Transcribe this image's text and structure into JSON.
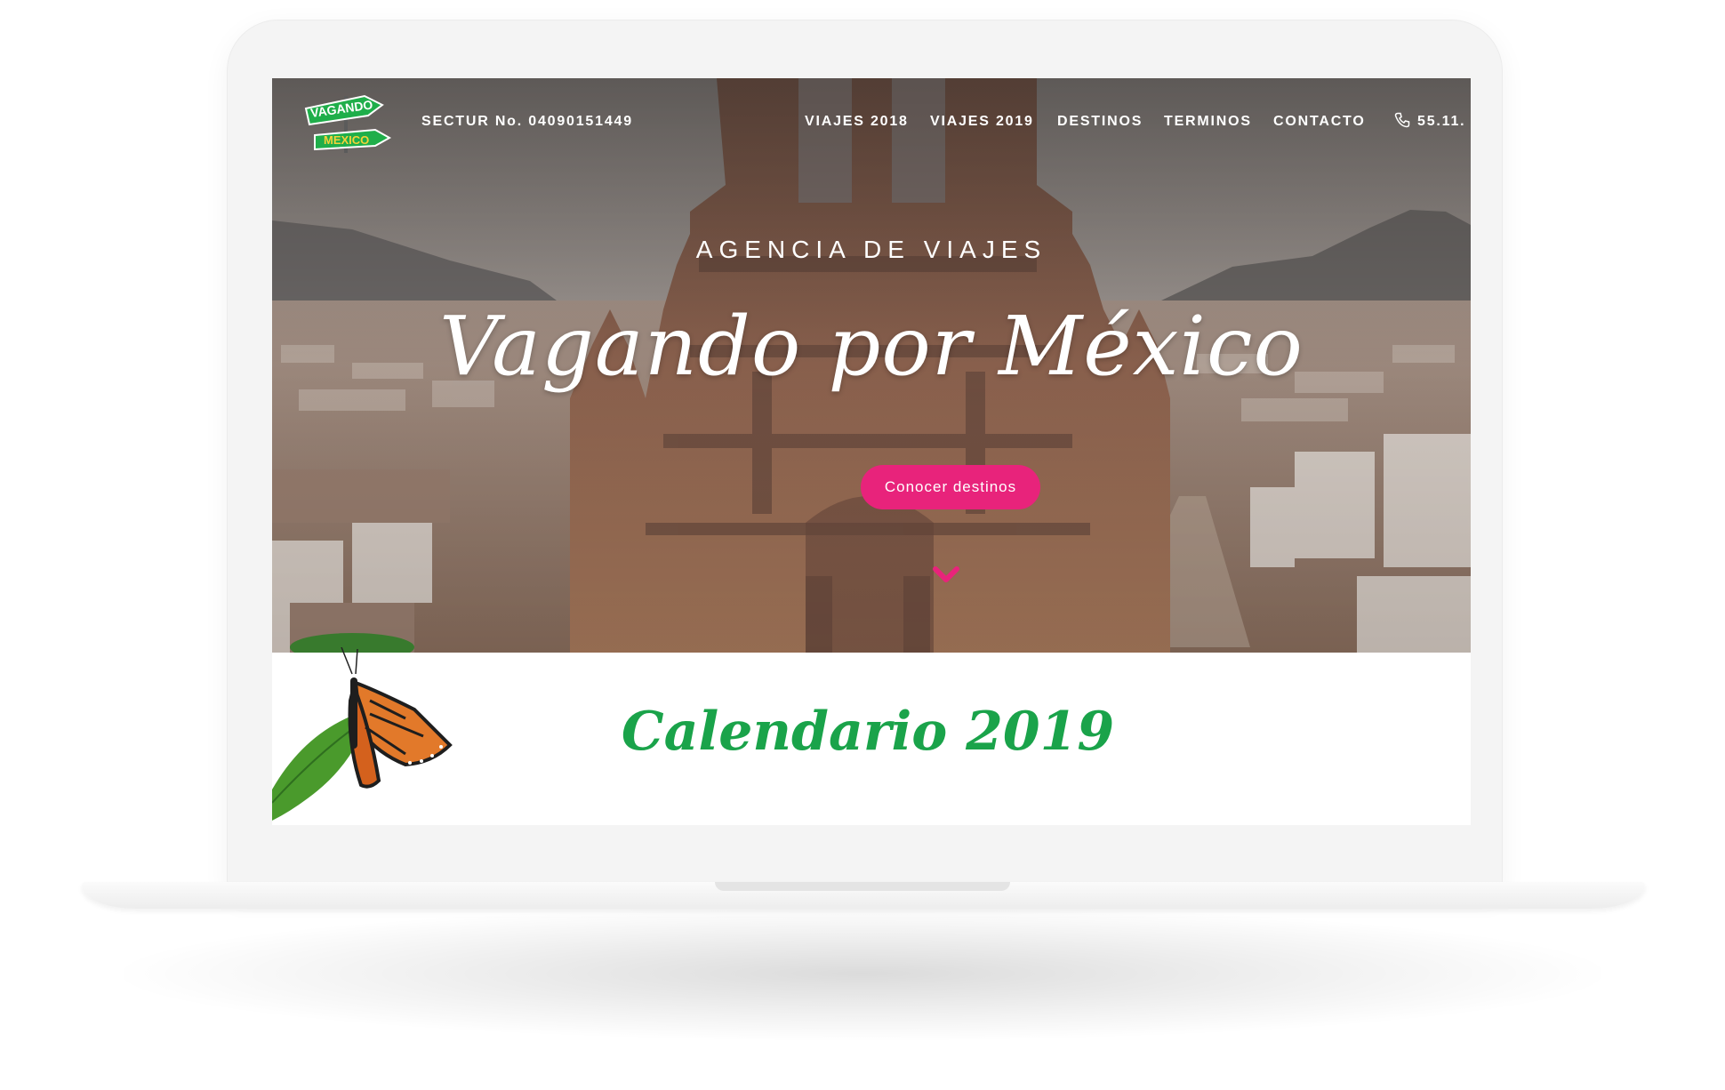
{
  "header": {
    "sectur": "SECTUR No. 04090151449",
    "nav": [
      "VIAJES 2018",
      "VIAJES 2019",
      "DESTINOS",
      "TERMINOS",
      "CONTACTO"
    ],
    "phone": "55.11."
  },
  "logo": {
    "top_text": "VAGANDO",
    "bottom_text": "MEXICO"
  },
  "hero": {
    "kicker": "AGENCIA DE VIAJES",
    "title": "Vagando por México",
    "cta_label": "Conocer destinos"
  },
  "calendar": {
    "title": "Calendario 2019"
  },
  "colors": {
    "accent": "#e8237b",
    "brand_green": "#1aa34a"
  }
}
